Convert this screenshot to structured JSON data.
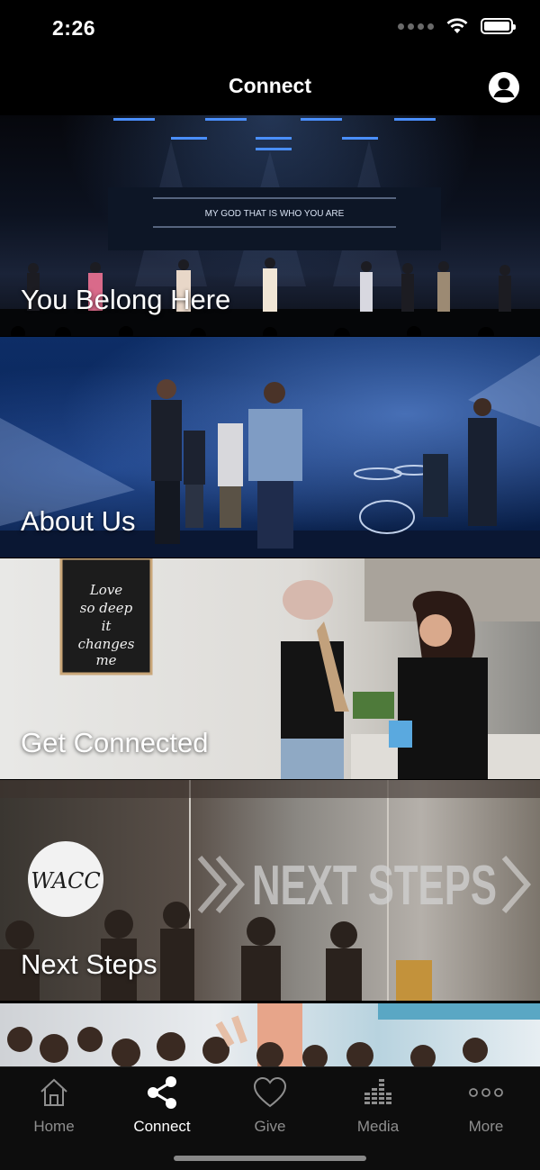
{
  "status_bar": {
    "time": "2:26"
  },
  "nav": {
    "title": "Connect"
  },
  "tiles": [
    {
      "label": "You Belong Here",
      "screen_text": "MY GOD THAT IS WHO YOU ARE"
    },
    {
      "label": "About Us"
    },
    {
      "label": "Get Connected",
      "sign_text": "Love so deep it changes me"
    },
    {
      "label": "Next Steps",
      "logo_text": "WACC",
      "wall_text": "NEXT STEPS"
    },
    {
      "label": ""
    }
  ],
  "tab_bar": {
    "tabs": [
      {
        "label": "Home",
        "icon": "home-icon",
        "active": false
      },
      {
        "label": "Connect",
        "icon": "share-icon",
        "active": true
      },
      {
        "label": "Give",
        "icon": "heart-icon",
        "active": false
      },
      {
        "label": "Media",
        "icon": "equalizer-icon",
        "active": false
      },
      {
        "label": "More",
        "icon": "more-icon",
        "active": false
      }
    ]
  }
}
